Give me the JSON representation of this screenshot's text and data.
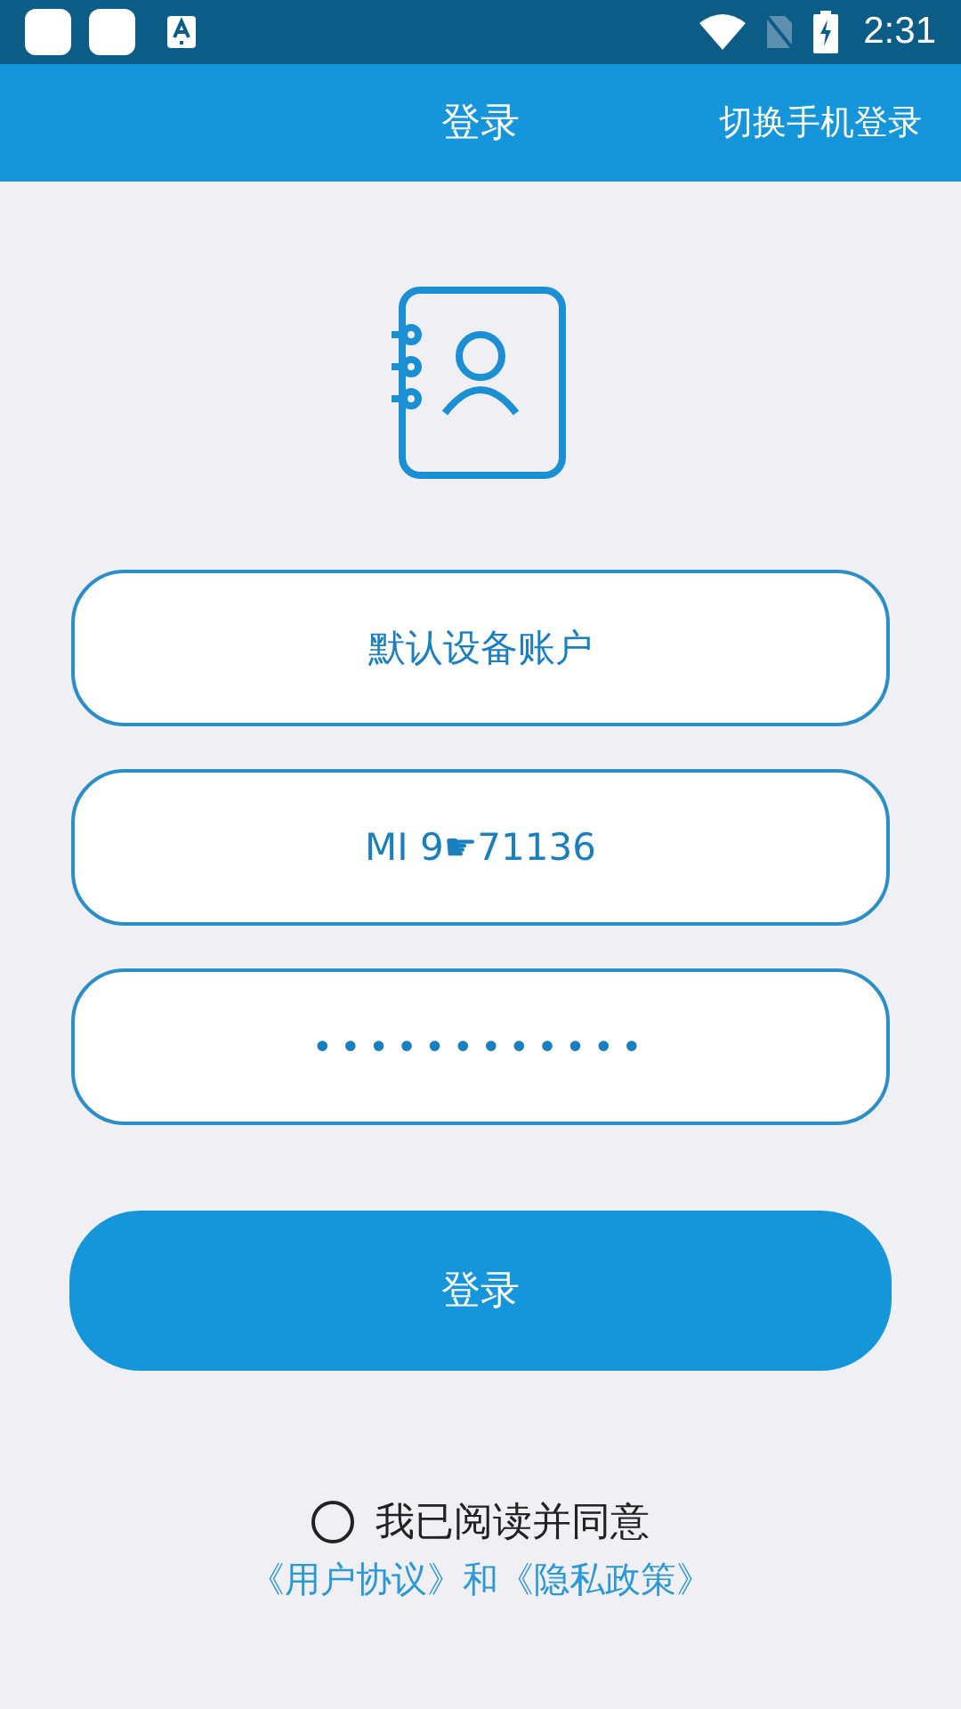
{
  "status_bar": {
    "time": "2:31"
  },
  "app_bar": {
    "title": "登录",
    "action": "切换手机登录"
  },
  "fields": [
    {
      "kind": "text",
      "value": "默认设备账户"
    },
    {
      "kind": "text",
      "value": "MI 9☛71136"
    },
    {
      "kind": "password",
      "value": "••••••••••••"
    }
  ],
  "login_button": "登录",
  "agreement": {
    "checked": false,
    "text": "我已阅读并同意",
    "links": [
      "《用户协议》",
      "《隐私政策》"
    ],
    "joiner": "和"
  }
}
